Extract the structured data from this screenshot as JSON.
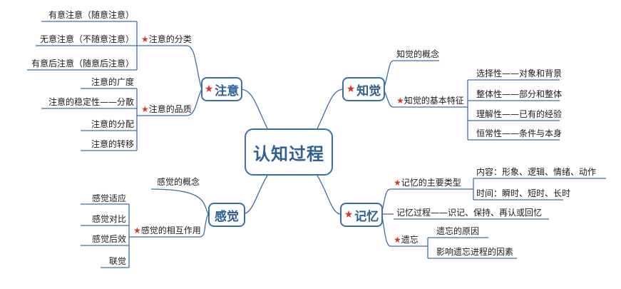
{
  "colors": {
    "line": "#3a6fa8",
    "star": "#d9342b",
    "text": "#1a1a1a",
    "center_text": "#2f5f93"
  },
  "center": {
    "label": "认知过程"
  },
  "branches": {
    "attention": {
      "label": "注意",
      "classification": {
        "label": "注意的分类",
        "items": [
          "有意注意（随意注意）",
          "无意注意（不随意注意）",
          "有意后注意（随意后注意）"
        ]
      },
      "quality": {
        "label": "注意的品质",
        "items": [
          "注意的广度",
          "注意的稳定性——分散",
          "注意的分配",
          "注意的转移"
        ]
      }
    },
    "sensation": {
      "label": "感觉",
      "concept": "感觉的概念",
      "interaction": {
        "label": "感觉的相互作用",
        "items": [
          "感觉适应",
          "感觉对比",
          "感觉后效",
          "联觉"
        ]
      }
    },
    "perception": {
      "label": "知觉",
      "concept": "知觉的概念",
      "features": {
        "label": "知觉的基本特征",
        "items": [
          "选择性——对象和背景",
          "整体性——部分和整体",
          "理解性——已有的经验",
          "恒常性——条件与本身"
        ]
      }
    },
    "memory": {
      "label": "记忆",
      "types": {
        "label": "记忆的主要类型",
        "items": [
          "内容：形象、逻辑、情绪、动作",
          "时间：瞬时、短时、长时"
        ]
      },
      "process": "记忆过程——识记、保持、再认或回忆",
      "forgetting": {
        "label": "遗忘",
        "items": [
          "遗忘的原因",
          "影响遗忘进程的因素"
        ]
      }
    }
  }
}
